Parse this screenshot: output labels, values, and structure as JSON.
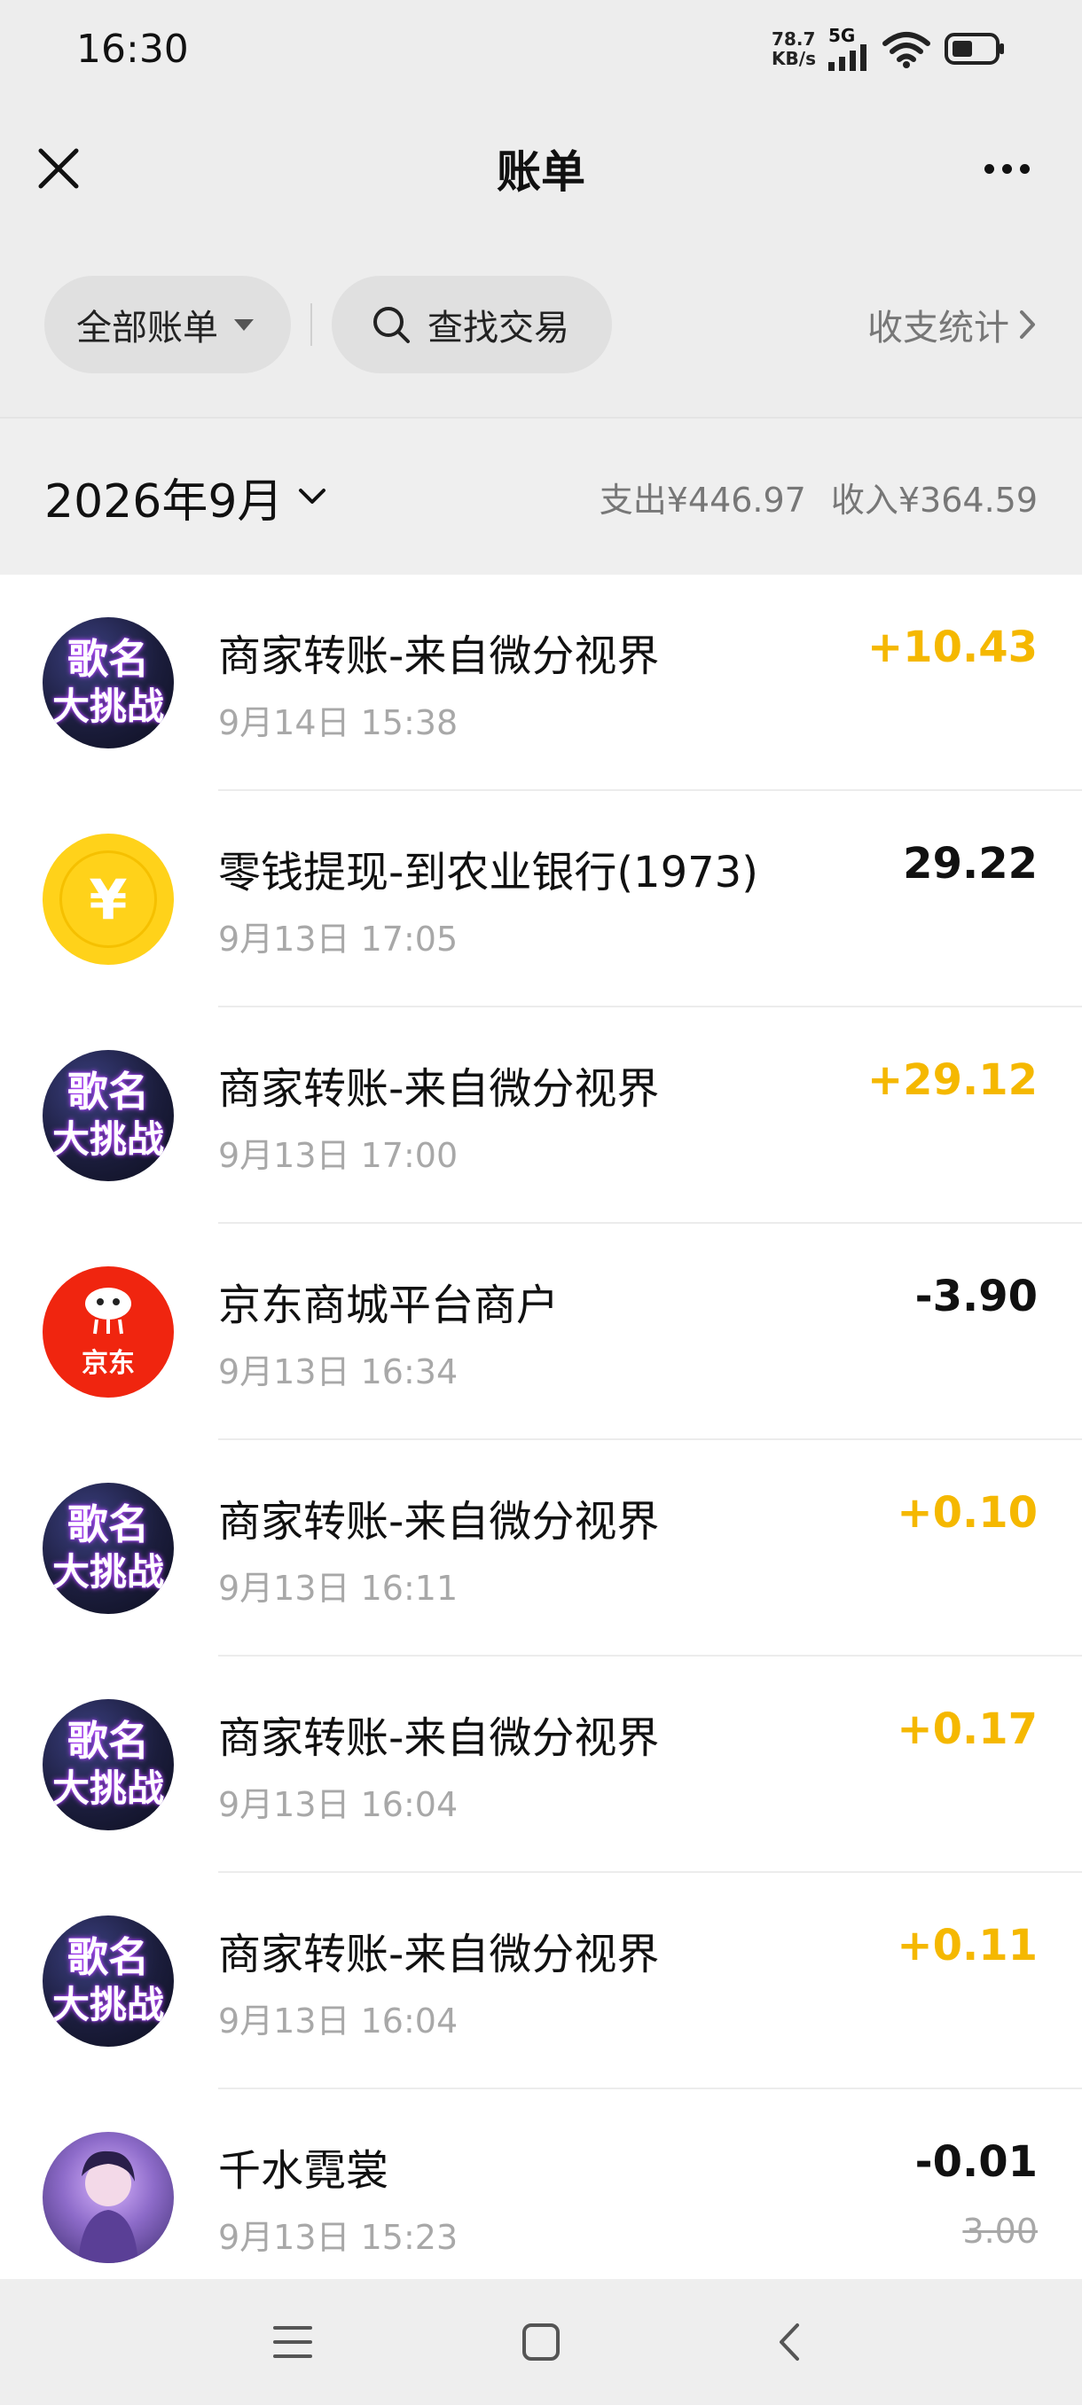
{
  "status_bar": {
    "time": "16:30",
    "net_speed_value": "78.7",
    "net_speed_unit": "KB/s",
    "network": "5G",
    "icons": [
      "signal-icon",
      "wifi-icon",
      "battery-icon"
    ]
  },
  "nav": {
    "title": "账单",
    "close_icon": "close-icon",
    "more_icon": "more-icon"
  },
  "filters": {
    "all_bills_label": "全部账单",
    "search_label": "查找交易",
    "stats_label": "收支统计"
  },
  "summary": {
    "month": "2026年9月",
    "expense": "支出¥446.97",
    "income": "收入¥364.59"
  },
  "colors": {
    "income_amount": "#f5b800",
    "expense_amount": "#111111",
    "jd_red": "#f0250f",
    "coin_yellow": "#ffd21a"
  },
  "transactions": [
    {
      "avatar": "game-avatar",
      "avatar_text_1": "歌名",
      "avatar_text_2": "大挑战",
      "title": "商家转账-来自微分视界",
      "time": "9月14日 15:38",
      "amount": "+10.43",
      "type": "income"
    },
    {
      "avatar": "coin-avatar",
      "avatar_symbol": "¥",
      "title": "零钱提现-到农业银行(1973)",
      "time": "9月13日 17:05",
      "amount": "29.22",
      "type": "expense"
    },
    {
      "avatar": "game-avatar",
      "avatar_text_1": "歌名",
      "avatar_text_2": "大挑战",
      "title": "商家转账-来自微分视界",
      "time": "9月13日 17:00",
      "amount": "+29.12",
      "type": "income"
    },
    {
      "avatar": "jd-avatar",
      "avatar_text": "京东",
      "title": "京东商城平台商户",
      "time": "9月13日 16:34",
      "amount": "-3.90",
      "type": "expense"
    },
    {
      "avatar": "game-avatar",
      "avatar_text_1": "歌名",
      "avatar_text_2": "大挑战",
      "title": "商家转账-来自微分视界",
      "time": "9月13日 16:11",
      "amount": "+0.10",
      "type": "income"
    },
    {
      "avatar": "game-avatar",
      "avatar_text_1": "歌名",
      "avatar_text_2": "大挑战",
      "title": "商家转账-来自微分视界",
      "time": "9月13日 16:04",
      "amount": "+0.17",
      "type": "income"
    },
    {
      "avatar": "game-avatar",
      "avatar_text_1": "歌名",
      "avatar_text_2": "大挑战",
      "title": "商家转账-来自微分视界",
      "time": "9月13日 16:04",
      "amount": "+0.11",
      "type": "income"
    },
    {
      "avatar": "person-avatar",
      "title": "千水霓裳",
      "time": "9月13日 15:23",
      "amount": "-0.01",
      "original_amount": "3.00",
      "type": "expense"
    }
  ],
  "bottom_nav": [
    "menu-icon",
    "home-icon",
    "back-icon"
  ]
}
